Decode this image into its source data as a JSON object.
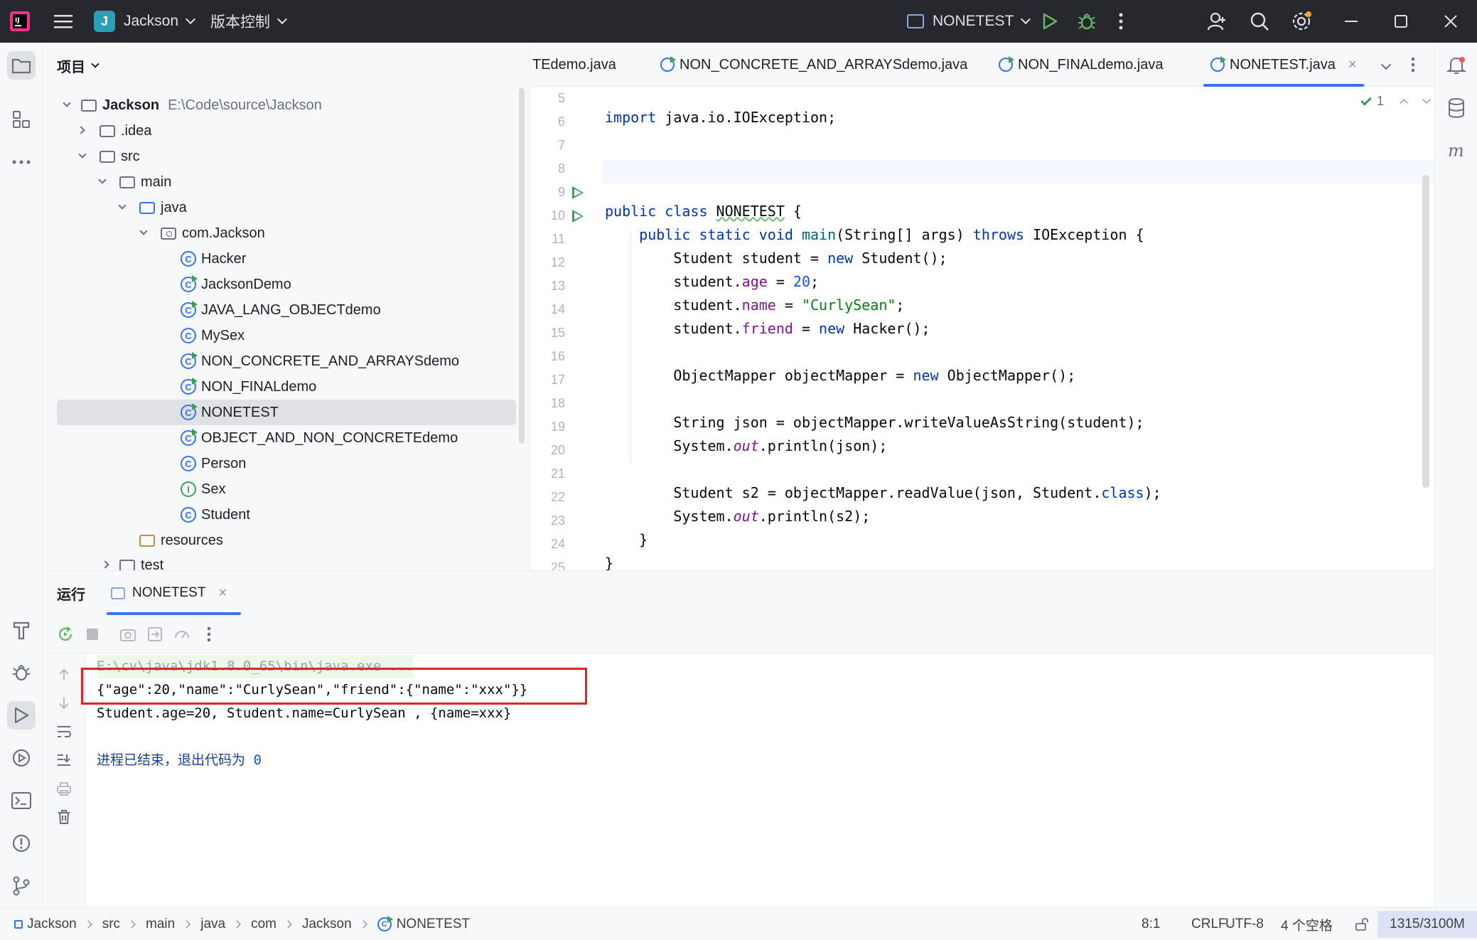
{
  "titlebar": {
    "project_badge": "J",
    "project_name": "Jackson",
    "vcs_label": "版本控制",
    "run_config": "NONETEST"
  },
  "project_panel": {
    "title": "项目",
    "root": {
      "name": "Jackson",
      "path": "E:\\Code\\source\\Jackson"
    },
    "folders": {
      "idea": ".idea",
      "src": "src",
      "main": "main",
      "java": "java",
      "package": "com.Jackson",
      "resources": "resources",
      "test": "test"
    },
    "classes": [
      {
        "name": "Hacker",
        "kind": "C"
      },
      {
        "name": "JacksonDemo",
        "kind": "C"
      },
      {
        "name": "JAVA_LANG_OBJECTdemo",
        "kind": "C"
      },
      {
        "name": "MySex",
        "kind": "C"
      },
      {
        "name": "NON_CONCRETE_AND_ARRAYSdemo",
        "kind": "C"
      },
      {
        "name": "NON_FINALdemo",
        "kind": "C"
      },
      {
        "name": "NONETEST",
        "kind": "C"
      },
      {
        "name": "OBJECT_AND_NON_CONCRETEdemo",
        "kind": "C"
      },
      {
        "name": "Person",
        "kind": "C"
      },
      {
        "name": "Sex",
        "kind": "I"
      },
      {
        "name": "Student",
        "kind": "C"
      }
    ]
  },
  "editor_tabs": [
    {
      "label": "TEdemo.java"
    },
    {
      "label": "NON_CONCRETE_AND_ARRAYSdemo.java"
    },
    {
      "label": "NON_FINALdemo.java"
    },
    {
      "label": "NONETEST.java"
    }
  ],
  "editor": {
    "inspection_count": "1",
    "line_numbers": [
      "5",
      "6",
      "7",
      "8",
      "9",
      "10",
      "11",
      "12",
      "13",
      "14",
      "15",
      "16",
      "17",
      "18",
      "19",
      "20",
      "21",
      "22",
      "23",
      "24",
      "25"
    ]
  },
  "run_panel": {
    "title": "运行",
    "tab_label": "NONETEST",
    "console": {
      "command": "E:\\cv\\java\\jdk1.8.0_65\\bin\\java.exe ...",
      "json_output": "{\"age\":20,\"name\":\"CurlySean\",\"friend\":{\"name\":\"xxx\"}}",
      "object_output": "Student.age=20, Student.name=CurlySean , {name=xxx}",
      "exit_message": "进程已结束，退出代码为 ",
      "exit_code": "0"
    }
  },
  "statusbar": {
    "breadcrumb": [
      "Jackson",
      "src",
      "main",
      "java",
      "com",
      "Jackson",
      "NONETEST"
    ],
    "position": "8:1",
    "line_sep": "CRLF",
    "encoding": "UTF-8",
    "indent": "4 个空格",
    "memory": "1315/3100M"
  },
  "colors": {
    "accent": "#3574f0",
    "run_green": "#3ca05a",
    "highlight_red": "#e02424",
    "titlebar_bg": "#27282e"
  }
}
